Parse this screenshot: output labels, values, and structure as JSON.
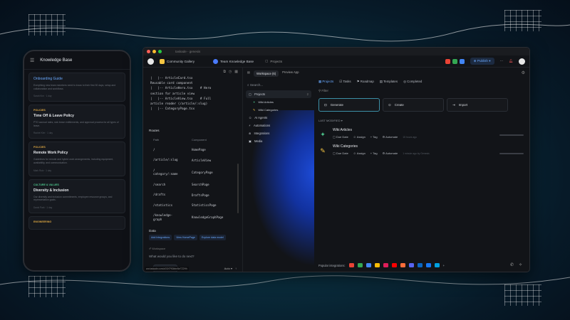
{
  "window": {
    "title": "taskade - genesis",
    "tabs": [
      "Community Gallery",
      "Team Knowledge Base",
      "Projects"
    ],
    "publish_label": "Publish",
    "url": "ww.taskade.com/a/01KPK6btmNeTZ2Hh"
  },
  "phone": {
    "title": "Knowledge Base",
    "cards": [
      {
        "tag": "",
        "title": "Onboarding Guide",
        "desc": "Everything new team members need to know to their first 30 days, setup and collaboration and workflows",
        "meta": "Sarah Kim  ·  1 day"
      },
      {
        "tag": "POLICIES",
        "title": "Time Off & Leave Policy",
        "desc": "PTO accrual rates, sick leave entitlements, and approval process for all types of leave.",
        "meta": "Rachel Kim  ·  1 day"
      },
      {
        "tag": "POLICIES",
        "title": "Remote Work Policy",
        "desc": "Guidelines for remote and hybrid work arrangements, including equipment, availability, and communication.",
        "meta": "Mark Ruiz  ·  1 day"
      },
      {
        "tag": "CULTURE & VALUES",
        "title": "Diversity & Inclusion",
        "desc": "Our diversity and inclusion commitments, employee resource groups, and representation goals.",
        "meta": "David Park  ·  1 day"
      },
      {
        "tag": "ENGINEERING",
        "title": "",
        "desc": "",
        "meta": ""
      }
    ]
  },
  "code": {
    "lines": [
      "|   |-- ArticleCard.tsx",
      "Reusable card component",
      "|   |-- ArticleHero.tsx    # Hero",
      "section for article view",
      "|   |-- ArticleView.tsx    # Full",
      "article reader (/article/:slug)",
      "|   |-- CategoryPage.tsx"
    ],
    "routes_title": "Routes",
    "routes_headers": [
      "Path",
      "Component"
    ],
    "routes": [
      {
        "path": "/",
        "component": "HomePage"
      },
      {
        "path": "/article/:slug",
        "component": "ArticleView"
      },
      {
        "path": "/\ncategory/:name",
        "component": "CategoryPage"
      },
      {
        "path": "/search",
        "component": "SearchPage"
      },
      {
        "path": "/drafts",
        "component": "DraftsPage"
      },
      {
        "path": "/statistics",
        "component": "StatisticsPage"
      },
      {
        "path": "/knowledge-\ngraph",
        "component": "KnowledgeGraphPage"
      }
    ],
    "data_title": "Data",
    "data_buttons": [
      "Add Integrations",
      "View HomePage",
      "Explore data model"
    ],
    "workspace_label": "Workspace",
    "ask_placeholder": "What would you like to do next?",
    "genesis_label": "Genesis AI",
    "auto_label": "Auto"
  },
  "nav": {
    "workspace_tab": "Workspace (6)",
    "preview_tab": "Preview App",
    "search_placeholder": "Search...",
    "items": [
      {
        "label": "Projects",
        "count": "2"
      },
      {
        "label": "Wiki Articles",
        "count": ""
      },
      {
        "label": "Wiki Categories",
        "count": ""
      },
      {
        "label": "AI Agents",
        "count": ""
      },
      {
        "label": "Automations",
        "count": ""
      },
      {
        "label": "Integrations",
        "count": ""
      },
      {
        "label": "Media",
        "count": ""
      }
    ]
  },
  "main": {
    "tabs": [
      "Projects",
      "Tasks",
      "Roadmap",
      "Templates",
      "Completed"
    ],
    "filter_label": "Filter",
    "actions": [
      "Generate",
      "Create",
      "Import"
    ],
    "last_modified": "LAST MODIFIED",
    "rows": [
      {
        "title": "Wiki Articles",
        "time": "15 hours ago"
      },
      {
        "title": "Wiki Categories",
        "time": "1 minute ago by Genesis"
      }
    ],
    "row_actions": [
      "Due Date",
      "Assign",
      "Tag",
      "Automate"
    ],
    "popular_label": "Popular integrations:"
  },
  "colors": {
    "accent": "#6aa9ff",
    "teal": "#3c8fa6",
    "bg": "#121418"
  }
}
